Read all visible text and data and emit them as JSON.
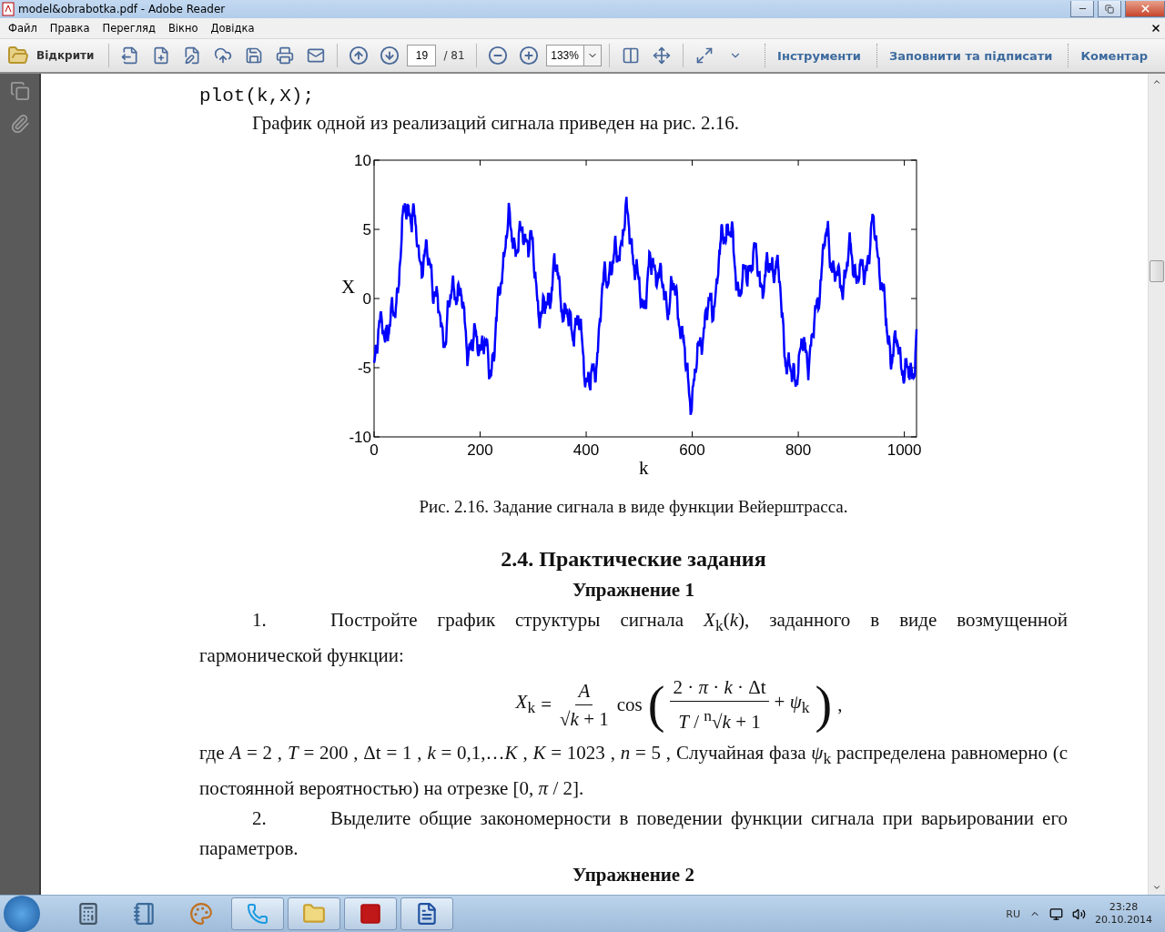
{
  "window": {
    "title": "model&obrabotka.pdf - Adobe Reader"
  },
  "menu": [
    "Файл",
    "Правка",
    "Перегляд",
    "Вікно",
    "Довідка"
  ],
  "toolbar": {
    "open_label": "Відкрити",
    "page": "19",
    "page_total": "/ 81",
    "zoom": "133%",
    "panels": [
      "Інструменти",
      "Заповнити та підписати",
      "Коментар"
    ]
  },
  "document": {
    "code": "plot(k,X);",
    "intro": "График одной из реализаций сигнала приведен на рис. 2.16.",
    "figure": {
      "ylabel": "X",
      "xlabel": "k",
      "yticks": [
        "10",
        "5",
        "0",
        "-5",
        "-10"
      ],
      "xticks": [
        "0",
        "200",
        "400",
        "600",
        "800",
        "1000"
      ]
    },
    "caption": "Рис. 2.16. Задание сигнала в виде функции Вейерштрасса.",
    "heading": "2.4. Практические задания",
    "subheading": "Упражнение 1",
    "item1_number": "1.",
    "item1_text": "Постройте график структуры сигнала *X*$_{k}$(*k*), заданного в виде возмущенной гармонической функции:",
    "formula": {
      "lhs": "*X*$_{k}$",
      "eq": "=",
      "num1": "*A*",
      "den1": "√*k* + 1",
      "func": "cos",
      "open": "(",
      "num2": "2 · *π* · *k* · Δt",
      "den2": "*T* / $^{n}$√*k* + 1",
      "tail": "+ *ψ*$_{k}$",
      "close": ")",
      "end": ","
    },
    "params": "где    *A* = 2 ,    *T* = 200 ,    Δt = 1 ,    *k* = 0,1,…*K* ,    *K* = 1023 ,    *n* = 5 ,   Случайная   фаза   *ψ*$_{k}$ распределена равномерно (с постоянной вероятностью) на отрезке [0, *π* / 2].",
    "item2_number": "2.",
    "item2_text": "Выделите общие закономерности в поведении функции сигнала при варьировании его параметров.",
    "next_heading": "Упражнение 2"
  },
  "taskbar": {
    "language": "RU",
    "time": "23:28",
    "date": "20.10.2014"
  }
}
